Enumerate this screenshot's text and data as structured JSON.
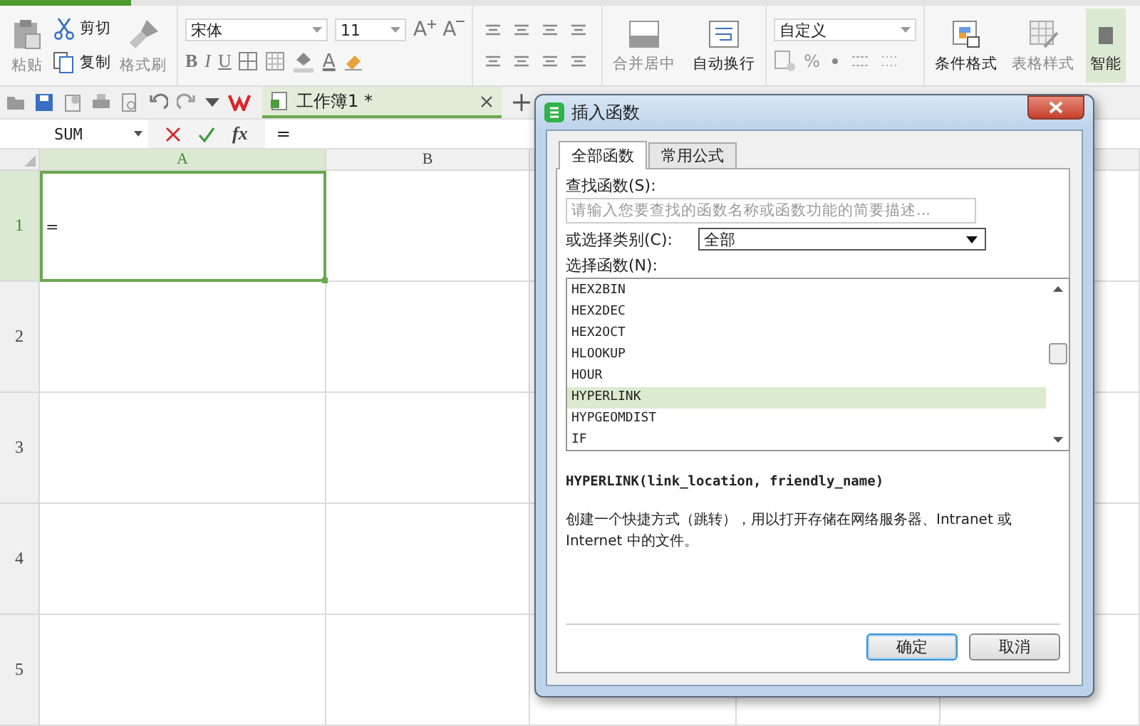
{
  "ribbon": {
    "clipboard": {
      "paste": "粘贴",
      "cut": "剪切",
      "copy": "复制",
      "format_painter": "格式刷"
    },
    "font": {
      "name": "宋体",
      "size": "11",
      "grow": "A",
      "shrink": "A",
      "bold": "B",
      "italic": "I",
      "underline": "U",
      "font_color": "A"
    },
    "alignment": {
      "merge_center": "合并居中",
      "wrap_text": "自动换行"
    },
    "number": {
      "format": "自定义",
      "percent": "%"
    },
    "styles": {
      "conditional_format": "条件格式",
      "table_style": "表格样式",
      "smart": "智能"
    }
  },
  "document_tab": {
    "title": "工作簿1 *"
  },
  "formula_bar": {
    "name_box": "SUM",
    "fx": "fx",
    "formula": "="
  },
  "sheet": {
    "columns": [
      {
        "label": "A",
        "selected": true
      },
      {
        "label": "B",
        "selected": false
      }
    ],
    "rows": [
      {
        "label": "1",
        "selected": true
      },
      {
        "label": "2",
        "selected": false
      },
      {
        "label": "3",
        "selected": false
      },
      {
        "label": "4",
        "selected": false
      },
      {
        "label": "5",
        "selected": false
      }
    ],
    "active_value": "="
  },
  "dialog": {
    "title": "插入函数",
    "tabs": [
      {
        "label": "全部函数",
        "selected": true
      },
      {
        "label": "常用公式",
        "selected": false
      }
    ],
    "search": {
      "label": "查找函数(S):",
      "placeholder": "请输入您要查找的函数名称或函数功能的简要描述..."
    },
    "category": {
      "label": "或选择类别(C):",
      "value": "全部"
    },
    "function_list": {
      "label": "选择函数(N):",
      "items": [
        {
          "name": "HEX2BIN",
          "selected": false
        },
        {
          "name": "HEX2DEC",
          "selected": false
        },
        {
          "name": "HEX2OCT",
          "selected": false
        },
        {
          "name": "HLOOKUP",
          "selected": false
        },
        {
          "name": "HOUR",
          "selected": false
        },
        {
          "name": "HYPERLINK",
          "selected": true
        },
        {
          "name": "HYPGEOMDIST",
          "selected": false
        },
        {
          "name": "IF",
          "selected": false
        }
      ]
    },
    "signature": "HYPERLINK(link_location, friendly_name)",
    "description": "创建一个快捷方式（跳转），用以打开存储在网络服务器、Intranet 或 Internet 中的文件。",
    "buttons": [
      {
        "label": "确定",
        "kind": "primary"
      },
      {
        "label": "取消",
        "kind": "secondary"
      }
    ]
  }
}
